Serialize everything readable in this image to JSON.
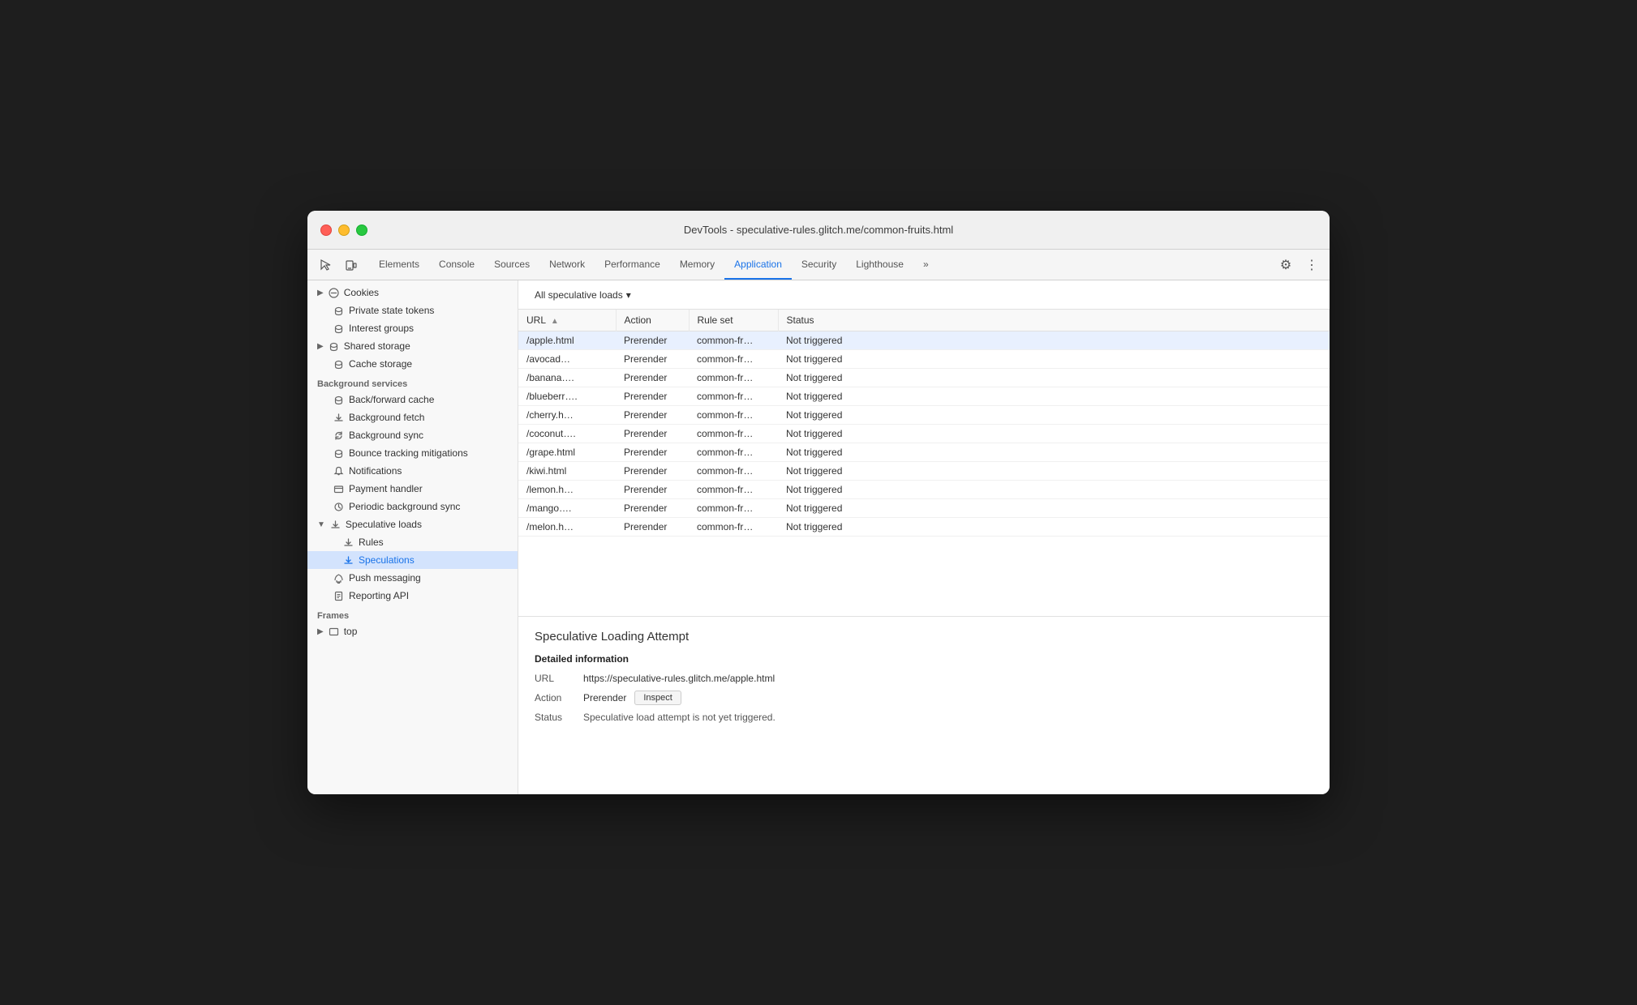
{
  "window": {
    "title": "DevTools - speculative-rules.glitch.me/common-fruits.html"
  },
  "toolbar": {
    "tabs": [
      {
        "label": "Elements",
        "active": false
      },
      {
        "label": "Console",
        "active": false
      },
      {
        "label": "Sources",
        "active": false
      },
      {
        "label": "Network",
        "active": false
      },
      {
        "label": "Performance",
        "active": false
      },
      {
        "label": "Memory",
        "active": false
      },
      {
        "label": "Application",
        "active": true
      },
      {
        "label": "Security",
        "active": false
      },
      {
        "label": "Lighthouse",
        "active": false
      }
    ]
  },
  "sidebar": {
    "sections": [
      {
        "items": [
          {
            "label": "Cookies",
            "icon": "▶",
            "indent": 0,
            "hasExpand": true,
            "iconType": "db"
          },
          {
            "label": "Private state tokens",
            "icon": "",
            "indent": 0,
            "iconType": "db"
          },
          {
            "label": "Interest groups",
            "icon": "",
            "indent": 0,
            "iconType": "db"
          },
          {
            "label": "Shared storage",
            "icon": "▶",
            "indent": 0,
            "hasExpand": true,
            "iconType": "db"
          },
          {
            "label": "Cache storage",
            "icon": "",
            "indent": 0,
            "iconType": "db"
          }
        ]
      },
      {
        "title": "Background services",
        "items": [
          {
            "label": "Back/forward cache",
            "icon": "",
            "indent": 0,
            "iconType": "db"
          },
          {
            "label": "Background fetch",
            "icon": "",
            "indent": 0,
            "iconType": "arrow"
          },
          {
            "label": "Background sync",
            "icon": "",
            "indent": 0,
            "iconType": "sync"
          },
          {
            "label": "Bounce tracking mitigations",
            "icon": "",
            "indent": 0,
            "iconType": "db"
          },
          {
            "label": "Notifications",
            "icon": "",
            "indent": 0,
            "iconType": "bell"
          },
          {
            "label": "Payment handler",
            "icon": "",
            "indent": 0,
            "iconType": "card"
          },
          {
            "label": "Periodic background sync",
            "icon": "",
            "indent": 0,
            "iconType": "clock"
          },
          {
            "label": "Speculative loads",
            "icon": "▼",
            "indent": 0,
            "hasExpand": true,
            "iconType": "arrow",
            "expanded": true
          },
          {
            "label": "Rules",
            "icon": "",
            "indent": 1,
            "iconType": "arrow"
          },
          {
            "label": "Speculations",
            "icon": "",
            "indent": 1,
            "iconType": "arrow",
            "selected": true
          },
          {
            "label": "Push messaging",
            "icon": "",
            "indent": 0,
            "iconType": "cloud"
          },
          {
            "label": "Reporting API",
            "icon": "",
            "indent": 0,
            "iconType": "doc"
          }
        ]
      },
      {
        "title": "Frames",
        "items": [
          {
            "label": "top",
            "icon": "▶",
            "indent": 0,
            "hasExpand": true,
            "iconType": "frame"
          }
        ]
      }
    ]
  },
  "filter": {
    "label": "All speculative loads",
    "dropdown_icon": "▾"
  },
  "table": {
    "columns": [
      {
        "label": "URL",
        "sortable": true
      },
      {
        "label": "Action"
      },
      {
        "label": "Rule set"
      },
      {
        "label": "Status"
      }
    ],
    "rows": [
      {
        "url": "/apple.html",
        "action": "Prerender",
        "rule_set": "common-fr…",
        "status": "Not triggered",
        "selected": true
      },
      {
        "url": "/avocad…",
        "action": "Prerender",
        "rule_set": "common-fr…",
        "status": "Not triggered",
        "selected": false
      },
      {
        "url": "/banana….",
        "action": "Prerender",
        "rule_set": "common-fr…",
        "status": "Not triggered",
        "selected": false
      },
      {
        "url": "/blueberr….",
        "action": "Prerender",
        "rule_set": "common-fr…",
        "status": "Not triggered",
        "selected": false
      },
      {
        "url": "/cherry.h…",
        "action": "Prerender",
        "rule_set": "common-fr…",
        "status": "Not triggered",
        "selected": false
      },
      {
        "url": "/coconut….",
        "action": "Prerender",
        "rule_set": "common-fr…",
        "status": "Not triggered",
        "selected": false
      },
      {
        "url": "/grape.html",
        "action": "Prerender",
        "rule_set": "common-fr…",
        "status": "Not triggered",
        "selected": false
      },
      {
        "url": "/kiwi.html",
        "action": "Prerender",
        "rule_set": "common-fr…",
        "status": "Not triggered",
        "selected": false
      },
      {
        "url": "/lemon.h…",
        "action": "Prerender",
        "rule_set": "common-fr…",
        "status": "Not triggered",
        "selected": false
      },
      {
        "url": "/mango….",
        "action": "Prerender",
        "rule_set": "common-fr…",
        "status": "Not triggered",
        "selected": false
      },
      {
        "url": "/melon.h…",
        "action": "Prerender",
        "rule_set": "common-fr…",
        "status": "Not triggered",
        "selected": false
      }
    ]
  },
  "detail": {
    "title": "Speculative Loading Attempt",
    "section_title": "Detailed information",
    "url_label": "URL",
    "url_value": "https://speculative-rules.glitch.me/apple.html",
    "action_label": "Action",
    "action_value": "Prerender",
    "inspect_label": "Inspect",
    "status_label": "Status",
    "status_value": "Speculative load attempt is not yet triggered."
  },
  "colors": {
    "active_tab": "#1a73e8",
    "selected_row_bg": "#e8f0fe",
    "selected_sidebar": "#d3e3fd"
  }
}
